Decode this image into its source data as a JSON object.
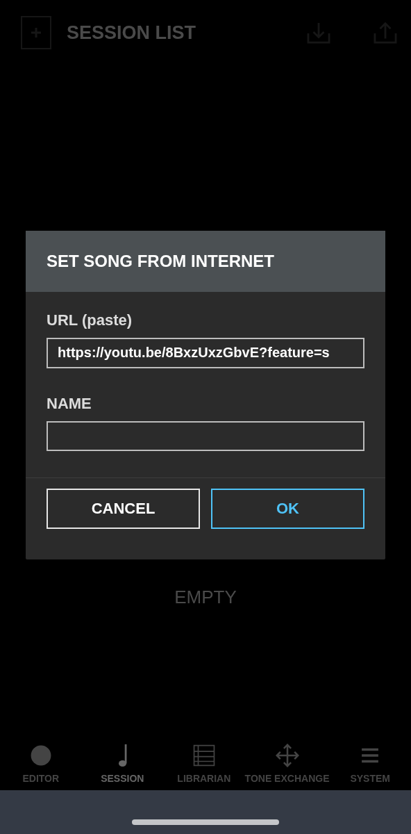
{
  "header": {
    "title": "SESSION LIST"
  },
  "empty_message": "EMPTY",
  "nav": [
    {
      "label": "EDITOR",
      "kind": "knob",
      "selected": false
    },
    {
      "label": "SESSION",
      "kind": "note",
      "selected": true
    },
    {
      "label": "LIBRARIAN",
      "kind": "list",
      "selected": false
    },
    {
      "label": "TONE EXCHANGE",
      "kind": "share",
      "selected": false
    },
    {
      "label": "SYSTEM",
      "kind": "menu",
      "selected": false
    }
  ],
  "dialog": {
    "title": "SET SONG FROM INTERNET",
    "fields": [
      {
        "label": "URL (paste)",
        "value": "https://youtu.be/8BxzUxzGbvE?feature=s"
      },
      {
        "label": "NAME"
      }
    ],
    "buttons": [
      {
        "label": "CANCEL",
        "kind": "secondary"
      },
      {
        "label": "OK",
        "kind": "primary"
      }
    ]
  }
}
